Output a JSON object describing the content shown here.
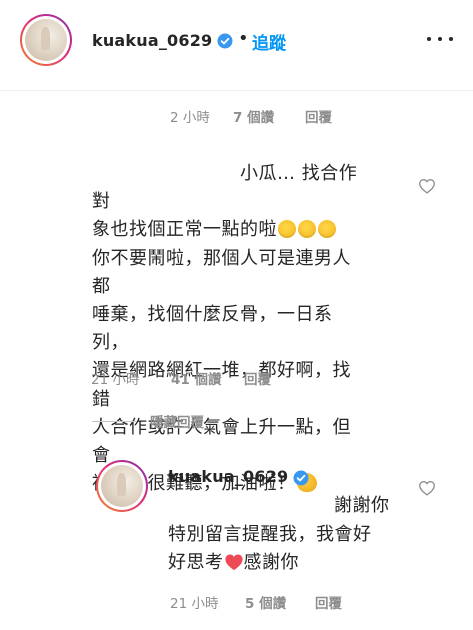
{
  "header": {
    "username": "kuakua_0629",
    "separator": "•",
    "follow_label": "追蹤"
  },
  "meta1": {
    "time": "2 小時",
    "likes": "7 個讚",
    "reply": "回覆"
  },
  "comment": {
    "line1": "小瓜… 找合作對",
    "line2": "象也找個正常一點的啦",
    "line3": "你不要鬧啦，那個人可是連男人都",
    "line4": "唾棄，找個什麼反骨，一日系列，",
    "line5": "還是網路網紅一堆，都好啊，找錯",
    "line6": "人合作或許人氣會上升一點，但會",
    "line7": "被黑的很難聽，加油啦！",
    "meta": {
      "time": "21 小時",
      "likes": "41 個讚",
      "reply": "回覆"
    }
  },
  "hide_replies_label": "隱藏回覆",
  "reply": {
    "username": "kuakua_0629",
    "line1": "謝謝你",
    "line2": "特別留言提醒我，我會好",
    "line3": "好思考",
    "line3b": "感謝你",
    "meta": {
      "time": "21 小時",
      "likes": "5 個讚",
      "reply": "回覆"
    }
  },
  "colors": {
    "follow": "#0095f6",
    "verified": "#3897f0",
    "meta": "#8e8e8e",
    "heart_red": "#ed4956"
  },
  "icons": {
    "verified": "verified-badge-icon",
    "more": "more-options-icon",
    "like": "heart-outline-icon",
    "emoji_laugh": "rolling-laughing-emoji",
    "emoji_muscle": "flexed-biceps-emoji",
    "emoji_heart": "red-heart-emoji"
  }
}
